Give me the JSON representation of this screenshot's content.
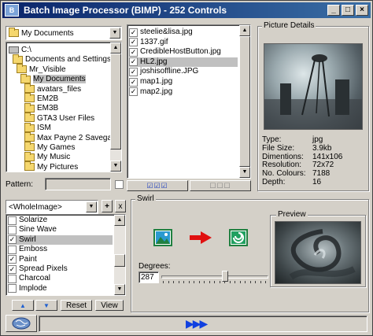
{
  "window": {
    "title": "Batch Image Processor (BIMP) - 252 Controls"
  },
  "folder_combo": {
    "value": "My Documents"
  },
  "folder_tree": [
    {
      "label": "C:\\",
      "type": "drive",
      "indent": 0,
      "selected": false
    },
    {
      "label": "Documents and Settings",
      "type": "folder",
      "indent": 1,
      "selected": false
    },
    {
      "label": "Mr_Visible",
      "type": "folder",
      "indent": 2,
      "selected": false
    },
    {
      "label": "My Documents",
      "type": "folder",
      "indent": 3,
      "selected": true
    },
    {
      "label": "avatars_files",
      "type": "folder",
      "indent": 4,
      "selected": false
    },
    {
      "label": "EM2B",
      "type": "folder",
      "indent": 4,
      "selected": false
    },
    {
      "label": "EM3B",
      "type": "folder",
      "indent": 4,
      "selected": false
    },
    {
      "label": "GTA3 User Files",
      "type": "folder",
      "indent": 4,
      "selected": false
    },
    {
      "label": "ISM",
      "type": "folder",
      "indent": 4,
      "selected": false
    },
    {
      "label": "Max Payne 2 Savegames",
      "type": "folder",
      "indent": 4,
      "selected": false
    },
    {
      "label": "My Games",
      "type": "folder",
      "indent": 4,
      "selected": false
    },
    {
      "label": "My Music",
      "type": "folder",
      "indent": 4,
      "selected": false
    },
    {
      "label": "My Pictures",
      "type": "folder",
      "indent": 4,
      "selected": false
    }
  ],
  "files": [
    {
      "name": "steelie&lisa.jpg",
      "checked": true,
      "selected": false
    },
    {
      "name": "1337.gif",
      "checked": true,
      "selected": false
    },
    {
      "name": "CredibleHostButton.jpg",
      "checked": true,
      "selected": false
    },
    {
      "name": "HL2.jpg",
      "checked": true,
      "selected": true
    },
    {
      "name": "joshisoffline.JPG",
      "checked": true,
      "selected": false
    },
    {
      "name": "map1.jpg",
      "checked": true,
      "selected": false
    },
    {
      "name": "map2.jpg",
      "checked": true,
      "selected": false
    }
  ],
  "pattern": {
    "label": "Pattern:",
    "value": ""
  },
  "picture_details": {
    "title": "Picture Details",
    "rows": [
      {
        "label": "Type:",
        "value": "jpg"
      },
      {
        "label": "File Size:",
        "value": "3.9kb"
      },
      {
        "label": "Dimentions:",
        "value": "141x106"
      },
      {
        "label": "Resolution:",
        "value": "72x72"
      },
      {
        "label": "No. Colours:",
        "value": "7188"
      },
      {
        "label": "Depth:",
        "value": "16"
      }
    ]
  },
  "effects_combo": {
    "value": "<WholeImage>",
    "add_label": "+",
    "remove_label": "x"
  },
  "effects": [
    {
      "name": "Solarize",
      "checked": false,
      "selected": false
    },
    {
      "name": "Sine Wave",
      "checked": false,
      "selected": false
    },
    {
      "name": "Swirl",
      "checked": true,
      "selected": true
    },
    {
      "name": "Emboss",
      "checked": false,
      "selected": false
    },
    {
      "name": "Paint",
      "checked": true,
      "selected": false
    },
    {
      "name": "Spread Pixels",
      "checked": true,
      "selected": false
    },
    {
      "name": "Charcoal",
      "checked": false,
      "selected": false
    },
    {
      "name": "Implode",
      "checked": false,
      "selected": false
    }
  ],
  "effect_buttons": {
    "up": "▲",
    "down": "▼",
    "reset": "Reset",
    "view": "View"
  },
  "swirl": {
    "title": "Swirl",
    "preview_title": "Preview",
    "degrees_label": "Degrees:",
    "degrees_value": "287",
    "slider_fraction": 0.6
  },
  "icons": {
    "arrow_color": "#e01010",
    "run_color": "#1040e0"
  },
  "status": {
    "run_glyph": "▶▶▶"
  }
}
